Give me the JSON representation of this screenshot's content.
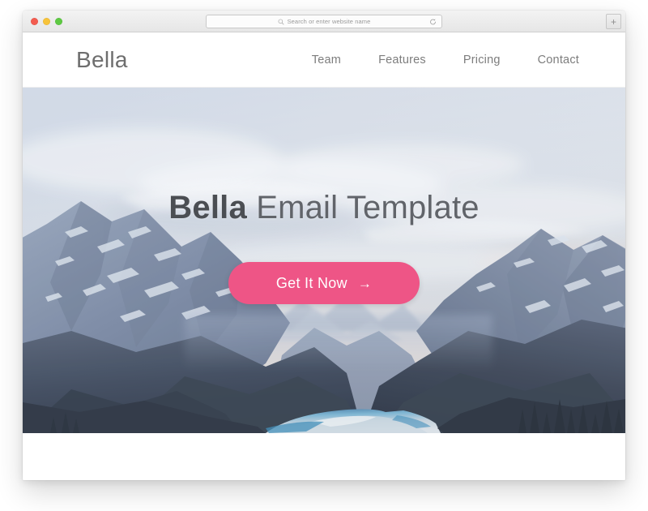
{
  "browser": {
    "traffic_lights": [
      {
        "name": "close",
        "color": "#f35c50"
      },
      {
        "name": "minimize",
        "color": "#f7c33a"
      },
      {
        "name": "zoom",
        "color": "#5dc942"
      }
    ],
    "address_bar": {
      "value": "",
      "placeholder": "Search or enter website name",
      "search_icon": "search-icon",
      "reload_icon": "reload-icon"
    },
    "new_tab_label": "+"
  },
  "site": {
    "brand": "Bella",
    "nav": [
      {
        "label": "Team"
      },
      {
        "label": "Features"
      },
      {
        "label": "Pricing"
      },
      {
        "label": "Contact"
      }
    ]
  },
  "hero": {
    "title_strong": "Bella",
    "title_rest": " Email Template",
    "cta_label": "Get It Now",
    "cta_arrow": "→",
    "cta_color": "#ee5586",
    "scene": "mountain-valley-lake-photo"
  }
}
